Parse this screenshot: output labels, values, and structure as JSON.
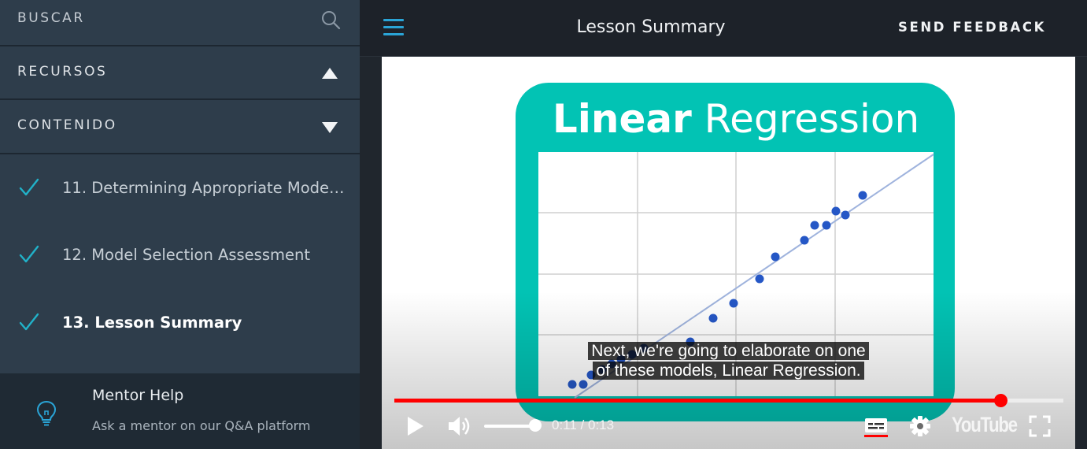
{
  "sidebar": {
    "search_label": "BUSCAR",
    "resources_label": "RECURSOS",
    "contents_label": "CONTENIDO",
    "lessons": [
      {
        "label": "11. Determining Appropriate Models...",
        "completed": true,
        "active": false
      },
      {
        "label": "12. Model Selection Assessment",
        "completed": true,
        "active": false
      },
      {
        "label": "13. Lesson Summary",
        "completed": true,
        "active": true
      }
    ],
    "mentor": {
      "title": "Mentor Help",
      "subtitle": "Ask a mentor on our Q&A platform"
    }
  },
  "header": {
    "title": "Lesson Summary",
    "feedback_label": "SEND FEEDBACK"
  },
  "video": {
    "slide_title_bold": "Linear",
    "slide_title_regular": "Regression",
    "caption_line1": "Next, we're going to elaborate on one",
    "caption_line2": "of these models, Linear Regression.",
    "time": "0:11 / 0:13",
    "progress_fraction": 0.906,
    "volume_fraction": 0.85,
    "logo_text": "YouTube"
  },
  "colors": {
    "sidebar_bg": "#2e3d4b",
    "topbar_bg": "#1d2229",
    "accent": "#2aa4d6",
    "check": "#21b2c9",
    "progress": "#ff0000",
    "teal": "#02c3b4"
  }
}
